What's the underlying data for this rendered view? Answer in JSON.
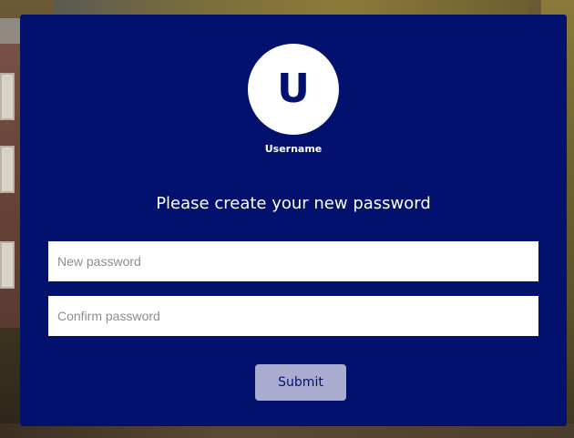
{
  "profile": {
    "avatar_letter": "U",
    "username": "Username"
  },
  "form": {
    "heading": "Please create your new password",
    "new_password": {
      "placeholder": "New password",
      "value": ""
    },
    "confirm_password": {
      "placeholder": "Confirm password",
      "value": ""
    },
    "submit_label": "Submit"
  },
  "colors": {
    "card_background": "#03116e",
    "submit_background": "#a9accf",
    "submit_text": "#03116e",
    "avatar_background": "#ffffff"
  }
}
